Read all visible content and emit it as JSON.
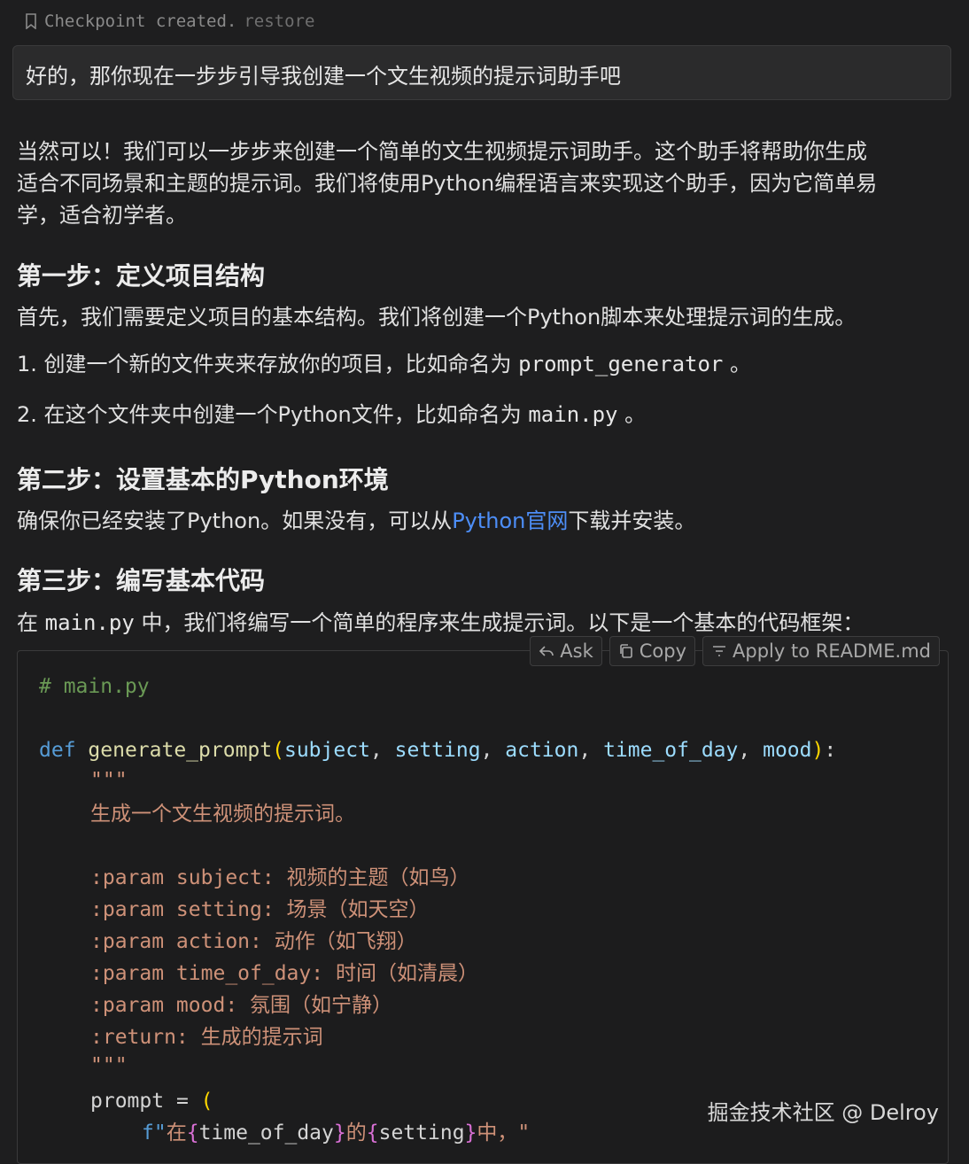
{
  "checkpoint": {
    "text": "Checkpoint created.",
    "restore": "restore"
  },
  "user_message": "好的，那你现在一步步引导我创建一个文生视频的提示词助手吧",
  "intro": [
    "当然可以！我们可以一步步来创建一个简单的文生视频提示词助手。这个助手将帮助你生成",
    "适合不同场景和主题的提示词。我们将使用Python编程语言来实现这个助手，因为它简单易",
    "学，适合初学者。"
  ],
  "step1": {
    "heading": "第一步：定义项目结构",
    "desc": "首先，我们需要定义项目的基本结构。我们将创建一个Python脚本来处理提示词的生成。",
    "item1_pre": "1. 创建一个新的文件夹来存放你的项目，比如命名为",
    "item1_code": "prompt_generator",
    "item1_post": "。",
    "item2_pre": "2. 在这个文件夹中创建一个Python文件，比如命名为",
    "item2_code": "main.py",
    "item2_post": "。"
  },
  "step2": {
    "heading": "第二步：设置基本的Python环境",
    "pre": "确保你已经安装了Python。如果没有，可以从",
    "link": "Python官网",
    "post": "下载并安装。"
  },
  "step3": {
    "heading": "第三步：编写基本代码",
    "pre": "在",
    "code": "main.py",
    "post": "中，我们将编写一个简单的程序来生成提示词。以下是一个基本的代码框架："
  },
  "toolbar": {
    "ask": "Ask",
    "copy": "Copy",
    "apply": "Apply to README.md"
  },
  "code": {
    "comment": "# main.py",
    "def": "def",
    "fn": "generate_prompt",
    "params": [
      "subject",
      "setting",
      "action",
      "time_of_day",
      "mood"
    ],
    "docq": "\"\"\"",
    "doc": "生成一个文生视频的提示词。",
    "p1": ":param subject: 视频的主题（如鸟）",
    "p2": ":param setting: 场景（如天空）",
    "p3": ":param action: 动作（如飞翔）",
    "p4": ":param time_of_day: 时间（如清晨）",
    "p5": ":param mood: 氛围（如宁静）",
    "ret": ":return: 生成的提示词",
    "prompt_var": "prompt",
    "eq": "=",
    "f_prefix": "f\"",
    "f_a": "在",
    "f_var1": "time_of_day",
    "f_b": "的",
    "f_var2": "setting",
    "f_c": "中，\""
  },
  "watermark": "掘金技术社区 @ Delroy"
}
